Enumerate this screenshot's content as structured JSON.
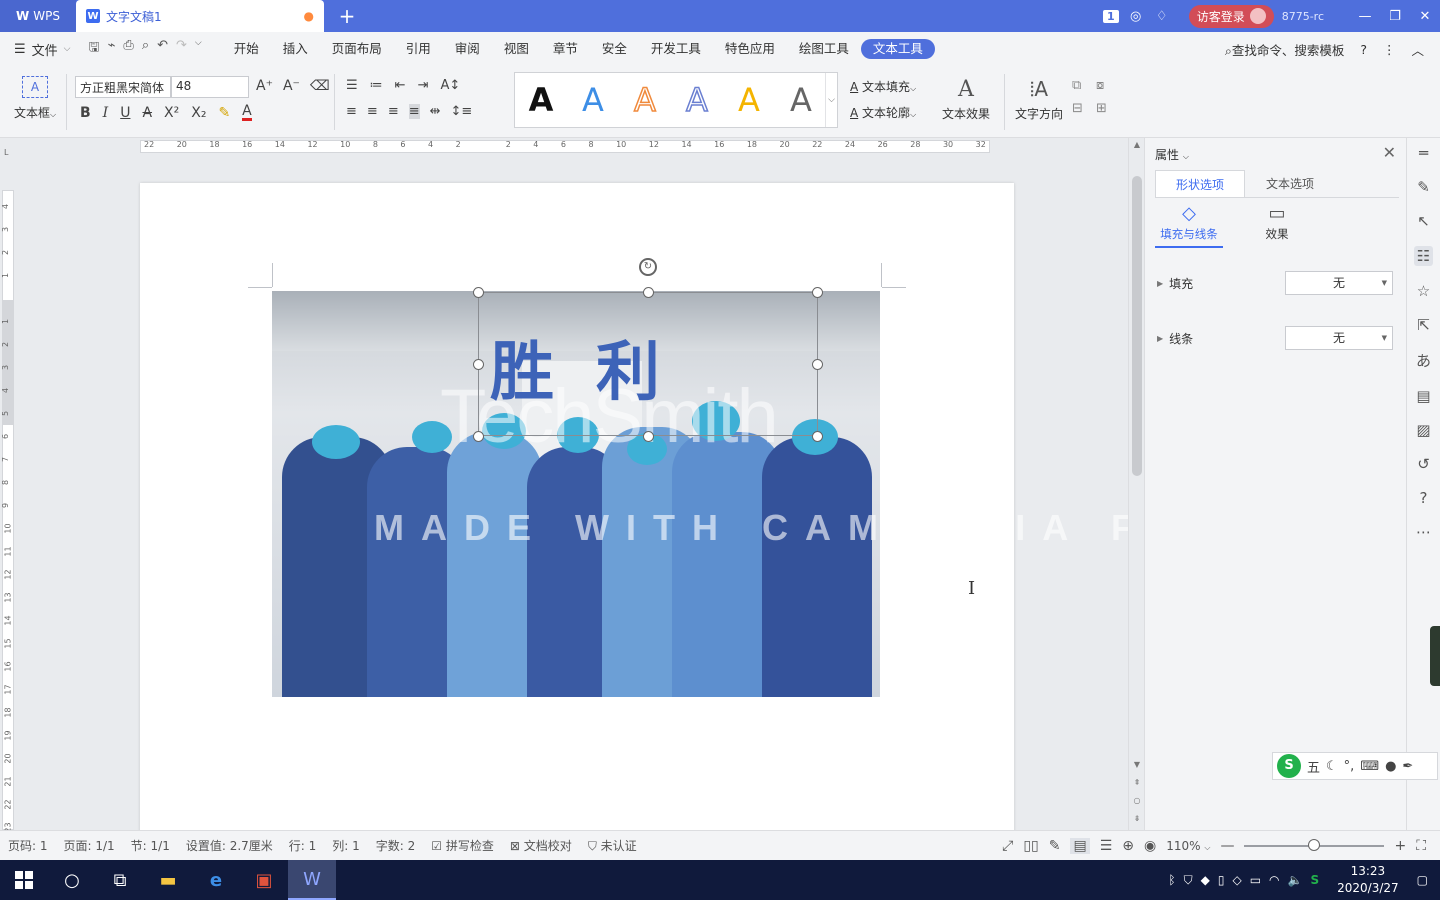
{
  "titlebar": {
    "app_tab": "WPS",
    "doc_tab": "文字文稿1",
    "new_tab": "+",
    "badge": "1",
    "guest_login": "访客登录",
    "user_id": "8775-rc"
  },
  "menubar": {
    "file": "文件",
    "items": [
      "开始",
      "插入",
      "页面布局",
      "引用",
      "审阅",
      "视图",
      "章节",
      "安全",
      "开发工具",
      "特色应用",
      "绘图工具",
      "文本工具"
    ],
    "active_item": "文本工具",
    "search": "查找命令、搜索模板"
  },
  "ribbon": {
    "textbox_label": "文本框",
    "font_name": "方正粗黑宋简体",
    "font_size": "48",
    "style_letters": [
      "A",
      "A",
      "A",
      "A",
      "A",
      "A"
    ],
    "style_colors": [
      "#111111",
      "#3d8ee6",
      "#f08a3c",
      "#6a7fd1",
      "#f4b400",
      "#666666"
    ],
    "text_fill": "文本填充",
    "text_outline": "文本轮廓",
    "text_effect": "文本效果",
    "text_direction": "文字方向"
  },
  "ruler": {
    "ticks": [
      "22",
      "20",
      "18",
      "16",
      "14",
      "12",
      "10",
      "8",
      "6",
      "4",
      "2",
      "",
      "2",
      "4",
      "6",
      "8",
      "10",
      "12",
      "14",
      "16",
      "18",
      "20",
      "22",
      "24",
      "26",
      "28",
      "30",
      "32"
    ],
    "vticks": [
      "4",
      "3",
      "2",
      "1",
      "",
      "1",
      "2",
      "3",
      "4",
      "5",
      "6",
      "7",
      "8",
      "9",
      "10",
      "11",
      "12",
      "13",
      "14",
      "15",
      "16",
      "17",
      "18",
      "19",
      "20",
      "21",
      "22",
      "23"
    ]
  },
  "document": {
    "textbox_text": "胜利",
    "watermark_brand": "TechSmith",
    "watermark_trial": "MADE WITH CAMTASIA FREE TRIAL"
  },
  "properties": {
    "title": "属性",
    "tab_shape": "形状选项",
    "tab_text": "文本选项",
    "sub_fill_line": "填充与线条",
    "sub_effect": "效果",
    "fill_label": "填充",
    "fill_value": "无",
    "line_label": "线条",
    "line_value": "无"
  },
  "ime": {
    "logo": "S",
    "mode": "五"
  },
  "statusbar": {
    "page_code": "页码: 1",
    "pages": "页面: 1/1",
    "section": "节: 1/1",
    "position": "设置值: 2.7厘米",
    "row": "行: 1",
    "col": "列: 1",
    "word_count": "字数: 2",
    "spellcheck": "拼写检查",
    "doc_check": "文档校对",
    "auth": "未认证",
    "zoom": "110%"
  },
  "taskbar": {
    "time": "13:23",
    "date": "2020/3/27"
  }
}
